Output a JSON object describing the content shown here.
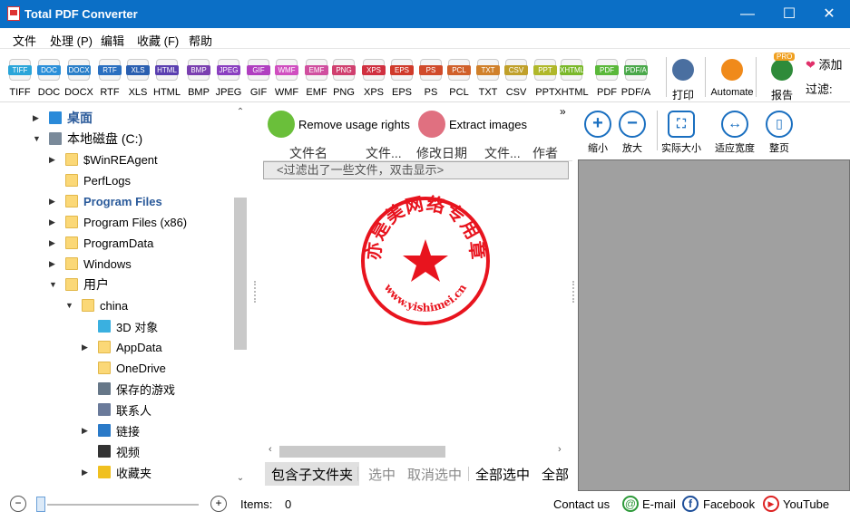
{
  "title_bar": {
    "title": "Total PDF Converter",
    "minimize": "—",
    "maximize": "☐",
    "close": "✕"
  },
  "menu": [
    "文件",
    "处理 (P)",
    "编辑",
    "收藏 (F)",
    "帮助"
  ],
  "formats": [
    {
      "label": "TIFF",
      "color": "#2aa5d9"
    },
    {
      "label": "DOC",
      "color": "#2a8fd9"
    },
    {
      "label": "DOCX",
      "color": "#2a7fc9"
    },
    {
      "label": "RTF",
      "color": "#2a6fc0"
    },
    {
      "label": "XLS",
      "color": "#2a5fb0"
    },
    {
      "label": "HTML",
      "color": "#5a3fb0"
    },
    {
      "label": "BMP",
      "color": "#7a3fb0"
    },
    {
      "label": "JPEG",
      "color": "#8a3fc0"
    },
    {
      "label": "GIF",
      "color": "#b03fc0"
    },
    {
      "label": "WMF",
      "color": "#d04fc0"
    },
    {
      "label": "EMF",
      "color": "#d04f9f"
    },
    {
      "label": "PNG",
      "color": "#d0406f"
    },
    {
      "label": "XPS",
      "color": "#d03040"
    },
    {
      "label": "EPS",
      "color": "#d03a2a"
    },
    {
      "label": "PS",
      "color": "#d04a2a"
    },
    {
      "label": "PCL",
      "color": "#d0602a"
    },
    {
      "label": "TXT",
      "color": "#d0802a"
    },
    {
      "label": "CSV",
      "color": "#c0a02a"
    },
    {
      "label": "PPT",
      "color": "#b0b82a"
    },
    {
      "label": "XHTML",
      "color": "#7ab82a"
    },
    {
      "label": "PDF",
      "color": "#5ab83a"
    },
    {
      "label": "PDF/A",
      "color": "#4aa84a"
    }
  ],
  "toolbar_right": {
    "print": "打印",
    "automate": "Automate",
    "report": "报告",
    "pro_badge": "PRO",
    "add": "添加",
    "filter_label": "过滤:"
  },
  "tree": [
    {
      "label": "桌面",
      "arrow": "▶",
      "kind": "desktop",
      "bold": true,
      "blue": true
    },
    {
      "label": "本地磁盘 (C:)",
      "arrow": "▼",
      "kind": "drive"
    },
    {
      "label": "$WinREAgent",
      "arrow": "▶",
      "kind": "folder"
    },
    {
      "label": "PerfLogs",
      "arrow": "",
      "kind": "folder"
    },
    {
      "label": "Program Files",
      "arrow": "▶",
      "kind": "folder",
      "bold": true,
      "blue": true
    },
    {
      "label": "Program Files (x86)",
      "arrow": "▶",
      "kind": "folder"
    },
    {
      "label": "ProgramData",
      "arrow": "▶",
      "kind": "folder"
    },
    {
      "label": "Windows",
      "arrow": "▶",
      "kind": "folder"
    },
    {
      "label": "用户",
      "arrow": "▼",
      "kind": "folder"
    },
    {
      "label": "china",
      "arrow": "▼",
      "kind": "folder"
    },
    {
      "label": "3D 对象",
      "arrow": "",
      "kind": "3d"
    },
    {
      "label": "AppData",
      "arrow": "▶",
      "kind": "folder"
    },
    {
      "label": "OneDrive",
      "arrow": "",
      "kind": "folder"
    },
    {
      "label": "保存的游戏",
      "arrow": "",
      "kind": "games"
    },
    {
      "label": "联系人",
      "arrow": "",
      "kind": "contacts"
    },
    {
      "label": "链接",
      "arrow": "▶",
      "kind": "links"
    },
    {
      "label": "视频",
      "arrow": "",
      "kind": "video"
    },
    {
      "label": "收藏夹",
      "arrow": "▶",
      "kind": "favorites"
    }
  ],
  "actions": {
    "remove_rights": "Remove usage rights",
    "extract_images": "Extract images",
    "more": "»"
  },
  "columns": [
    "文件名",
    "文件...",
    "修改日期",
    "文件...",
    "作者"
  ],
  "filter_notice": "<过滤出了一些文件，双击显示>",
  "stamp": {
    "arc_text": "亦是美网络专用章",
    "url": "www.yishimei.cn",
    "color": "#e8141e"
  },
  "bottom_tabs": [
    "包含子文件夹",
    "选中",
    "取消选中",
    "全部选中",
    "全部"
  ],
  "view_buttons": [
    "缩小",
    "放大",
    "实际大小",
    "适应宽度",
    "整页"
  ],
  "status": {
    "items_label": "Items:",
    "items_count": "0",
    "contact": "Contact us",
    "email": "E-mail",
    "facebook": "Facebook",
    "youtube": "YouTube"
  }
}
